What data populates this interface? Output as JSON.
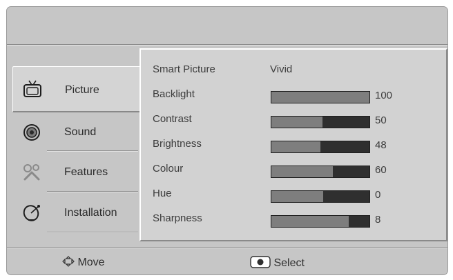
{
  "sidebar": {
    "items": [
      {
        "label": "Picture",
        "icon": "tv-icon"
      },
      {
        "label": "Sound",
        "icon": "speaker-icon"
      },
      {
        "label": "Features",
        "icon": "wrench-icon"
      },
      {
        "label": "Installation",
        "icon": "satellite-dish-icon"
      }
    ],
    "active": "Picture"
  },
  "settings": [
    {
      "label": "Smart Picture",
      "value": "Vivid"
    },
    {
      "label": "Backlight",
      "value": 100
    },
    {
      "label": "Contrast",
      "value": 50
    },
    {
      "label": "Brightness",
      "value": 48
    },
    {
      "label": "Colour",
      "value": 60
    },
    {
      "label": "Hue",
      "value": 0
    },
    {
      "label": "Sharpness",
      "value": 8
    }
  ],
  "slider_levels": {
    "Backlight": 1.0,
    "Contrast": 0.52,
    "Brightness": 0.5,
    "Colour": 0.63,
    "Hue": 0.53,
    "Sharpness": 0.79
  },
  "footer": {
    "move": {
      "label": "Move",
      "icon": "four-way-arrows-icon"
    },
    "select": {
      "label": "Select",
      "icon": "ok-button-icon"
    }
  },
  "colors": {
    "background": "#c6c6c6",
    "panel": "#d2d2d2",
    "slider_fill": "#7e7e7e",
    "slider_track": "#2f2f2f",
    "text": "#3c3c3c"
  }
}
